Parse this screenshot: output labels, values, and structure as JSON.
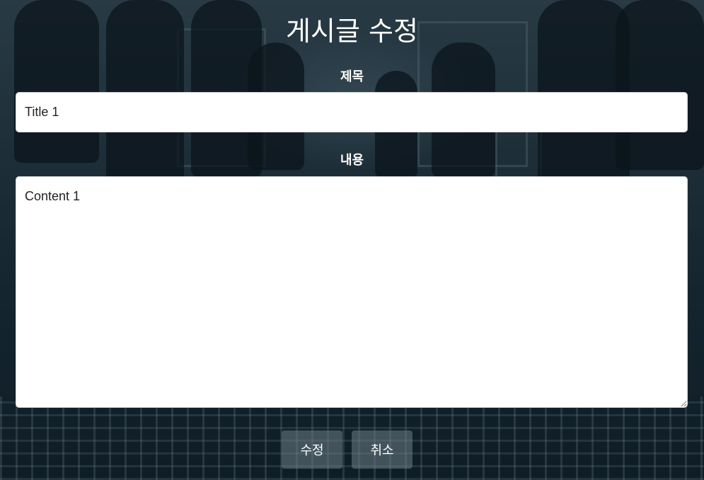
{
  "page": {
    "title": "게시글 수정"
  },
  "form": {
    "title_label": "제목",
    "title_value": "Title 1",
    "content_label": "내용",
    "content_value": "Content 1",
    "submit_label": "수정",
    "cancel_label": "취소"
  },
  "colors": {
    "text": "#ffffff",
    "field_background": "#ffffff",
    "button_background": "#6e7d87"
  }
}
